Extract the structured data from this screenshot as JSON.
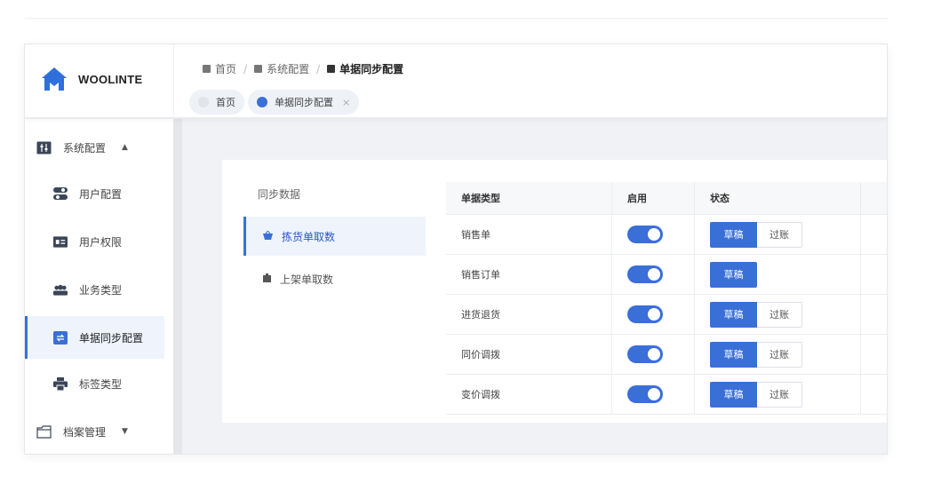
{
  "app": {
    "logo_text": "WOOLINTE",
    "brand_color": "#3a6fd8"
  },
  "breadcrumb": [
    "首页",
    "系统配置",
    "单据同步配置"
  ],
  "tabs": [
    {
      "label": "首页",
      "active": false
    },
    {
      "label": "单据同步配置",
      "active": true,
      "close": "×"
    }
  ],
  "sidebar": {
    "group1": {
      "label": "系统配置",
      "caret": "▲",
      "icon": "sliders-icon"
    },
    "items": [
      {
        "label": "用户配置",
        "icon": "toggle-icon"
      },
      {
        "label": "用户权限",
        "icon": "id-card-icon"
      },
      {
        "label": "业务类型",
        "icon": "users-icon"
      },
      {
        "label": "单据同步配置",
        "icon": "sync-icon",
        "active": true
      },
      {
        "label": "标签类型",
        "icon": "printer-icon"
      }
    ],
    "group2": {
      "label": "档案管理",
      "caret": "▼",
      "icon": "folder-icon"
    }
  },
  "sync_nav": {
    "title": "同步数据",
    "items": [
      {
        "label": "拣货单取数",
        "active": true,
        "icon": "basket-icon"
      },
      {
        "label": "上架单取数",
        "active": false,
        "icon": "box-icon"
      }
    ]
  },
  "table": {
    "headers": [
      "单据类型",
      "启用",
      "状态"
    ],
    "rows": [
      {
        "type": "销售单",
        "enabled": true,
        "draft": "草稿",
        "post": "过账"
      },
      {
        "type": "销售订单",
        "enabled": true,
        "draft": "草稿",
        "post": null
      },
      {
        "type": "进货退货",
        "enabled": true,
        "draft": "草稿",
        "post": "过账"
      },
      {
        "type": "同价调拨",
        "enabled": true,
        "draft": "草稿",
        "post": "过账"
      },
      {
        "type": "变价调拨",
        "enabled": true,
        "draft": "草稿",
        "post": "过账"
      }
    ]
  }
}
